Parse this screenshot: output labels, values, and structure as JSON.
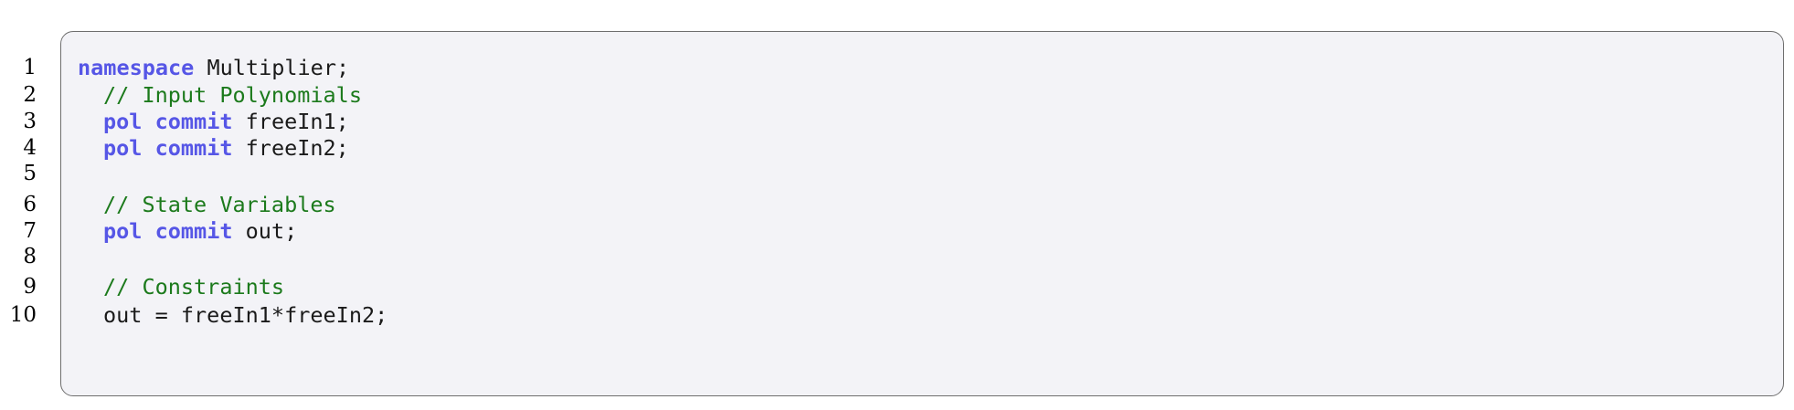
{
  "code": {
    "lines": [
      {
        "number": "1",
        "tokens": [
          {
            "type": "kw",
            "text": "namespace"
          },
          {
            "type": "tx",
            "text": " Multiplier;"
          }
        ],
        "indent": false
      },
      {
        "number": "2",
        "tokens": [
          {
            "type": "cm",
            "text": "// Input Polynomials"
          }
        ],
        "indent": true
      },
      {
        "number": "3",
        "tokens": [
          {
            "type": "kw",
            "text": "pol"
          },
          {
            "type": "tx",
            "text": " "
          },
          {
            "type": "kw",
            "text": "commit"
          },
          {
            "type": "tx",
            "text": " freeIn1;"
          }
        ],
        "indent": true
      },
      {
        "number": "4",
        "tokens": [
          {
            "type": "kw",
            "text": "pol"
          },
          {
            "type": "tx",
            "text": " "
          },
          {
            "type": "kw",
            "text": "commit"
          },
          {
            "type": "tx",
            "text": " freeIn2;"
          }
        ],
        "indent": true
      },
      {
        "number": "5",
        "tokens": [],
        "indent": true
      },
      {
        "number": "6",
        "tokens": [
          {
            "type": "cm",
            "text": "// State Variables"
          }
        ],
        "indent": true
      },
      {
        "number": "7",
        "tokens": [
          {
            "type": "kw",
            "text": "pol"
          },
          {
            "type": "tx",
            "text": " "
          },
          {
            "type": "kw",
            "text": "commit"
          },
          {
            "type": "tx",
            "text": " out;"
          }
        ],
        "indent": true
      },
      {
        "number": "8",
        "tokens": [],
        "indent": true
      },
      {
        "number": "9",
        "tokens": [
          {
            "type": "cm",
            "text": "// Constraints"
          }
        ],
        "indent": true
      },
      {
        "number": "10",
        "tokens": [
          {
            "type": "tx",
            "text": "out = freeIn1*freeIn2;"
          }
        ],
        "indent": true
      }
    ]
  },
  "colors": {
    "keyword": "#5656e6",
    "comment": "#1c7a1c",
    "text": "#1a1a1a",
    "background": "#f3f3f7",
    "border": "#6e6e6e"
  }
}
